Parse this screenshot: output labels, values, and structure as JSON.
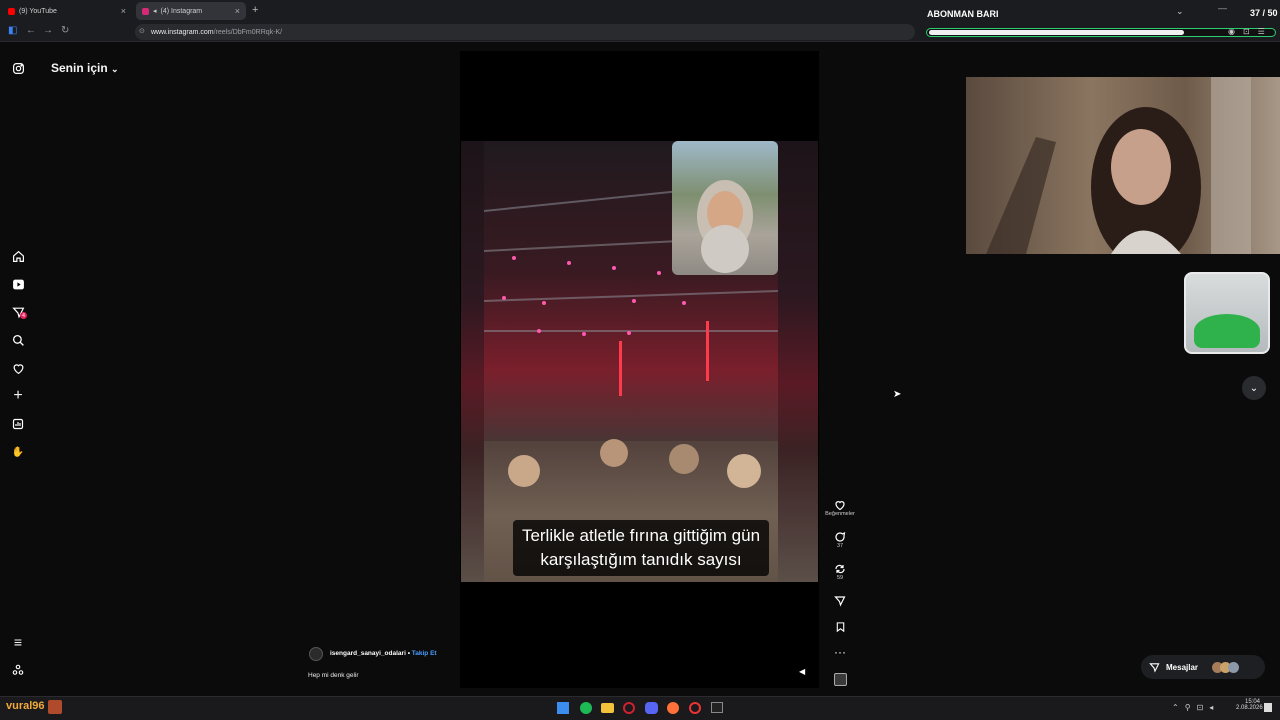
{
  "browser": {
    "tabs": [
      {
        "label": "(9) YouTube",
        "close": "×"
      },
      {
        "label": "(4) Instagram",
        "close": "×"
      }
    ],
    "new_tab": "+",
    "url_domain": "www.instagram.com",
    "url_path": "/reels/DbFm0RRqk-K/"
  },
  "sidebar": {
    "feed_title": "Senin için",
    "notification_count": "4"
  },
  "reel": {
    "caption_line1": "Terlikle atletle fırına gittiğim gün",
    "caption_line2": "karşılaştığım tanıdık sayısı",
    "author": "isengard_sanayi_odalari",
    "separator": "•",
    "follow_label": "Takip Et",
    "description": "Hep mi denk gelir",
    "likes_label": "Beğenmeler",
    "comments_count": "37",
    "reposts_count": "59",
    "more": "···"
  },
  "overlay": {
    "sub_bar_title": "ABONMAN BARI",
    "sub_count": "37 / 50",
    "sub_progress": 0.74
  },
  "messages": {
    "label": "Mesajlar"
  },
  "taskbar": {
    "username": "vural96",
    "time": "15:04",
    "date": "2.08.2026"
  },
  "colors": {
    "accent": "#2ecc71",
    "link": "#4a9eff",
    "badge": "#e0245e"
  }
}
